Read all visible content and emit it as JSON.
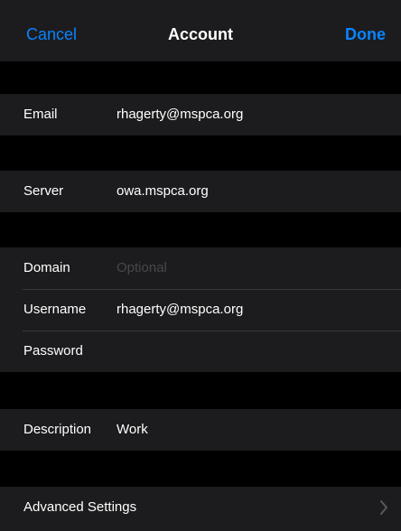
{
  "navbar": {
    "cancel_label": "Cancel",
    "title": "Account",
    "done_label": "Done"
  },
  "form": {
    "email": {
      "label": "Email",
      "value": "rhagerty@mspca.org"
    },
    "server": {
      "label": "Server",
      "value": "owa.mspca.org"
    },
    "domain": {
      "label": "Domain",
      "value": "",
      "placeholder": "Optional"
    },
    "username": {
      "label": "Username",
      "value": "rhagerty@mspca.org"
    },
    "password": {
      "label": "Password",
      "value": ""
    },
    "description": {
      "label": "Description",
      "value": "Work"
    },
    "advanced": {
      "label": "Advanced Settings"
    }
  },
  "colors": {
    "accent": "#0a84ff",
    "cell_background": "#1c1c1e",
    "page_background": "#000000",
    "separator": "#38383a",
    "placeholder_text": "#48484a"
  },
  "icons": {
    "advanced_chevron": "chevron-right-icon"
  }
}
